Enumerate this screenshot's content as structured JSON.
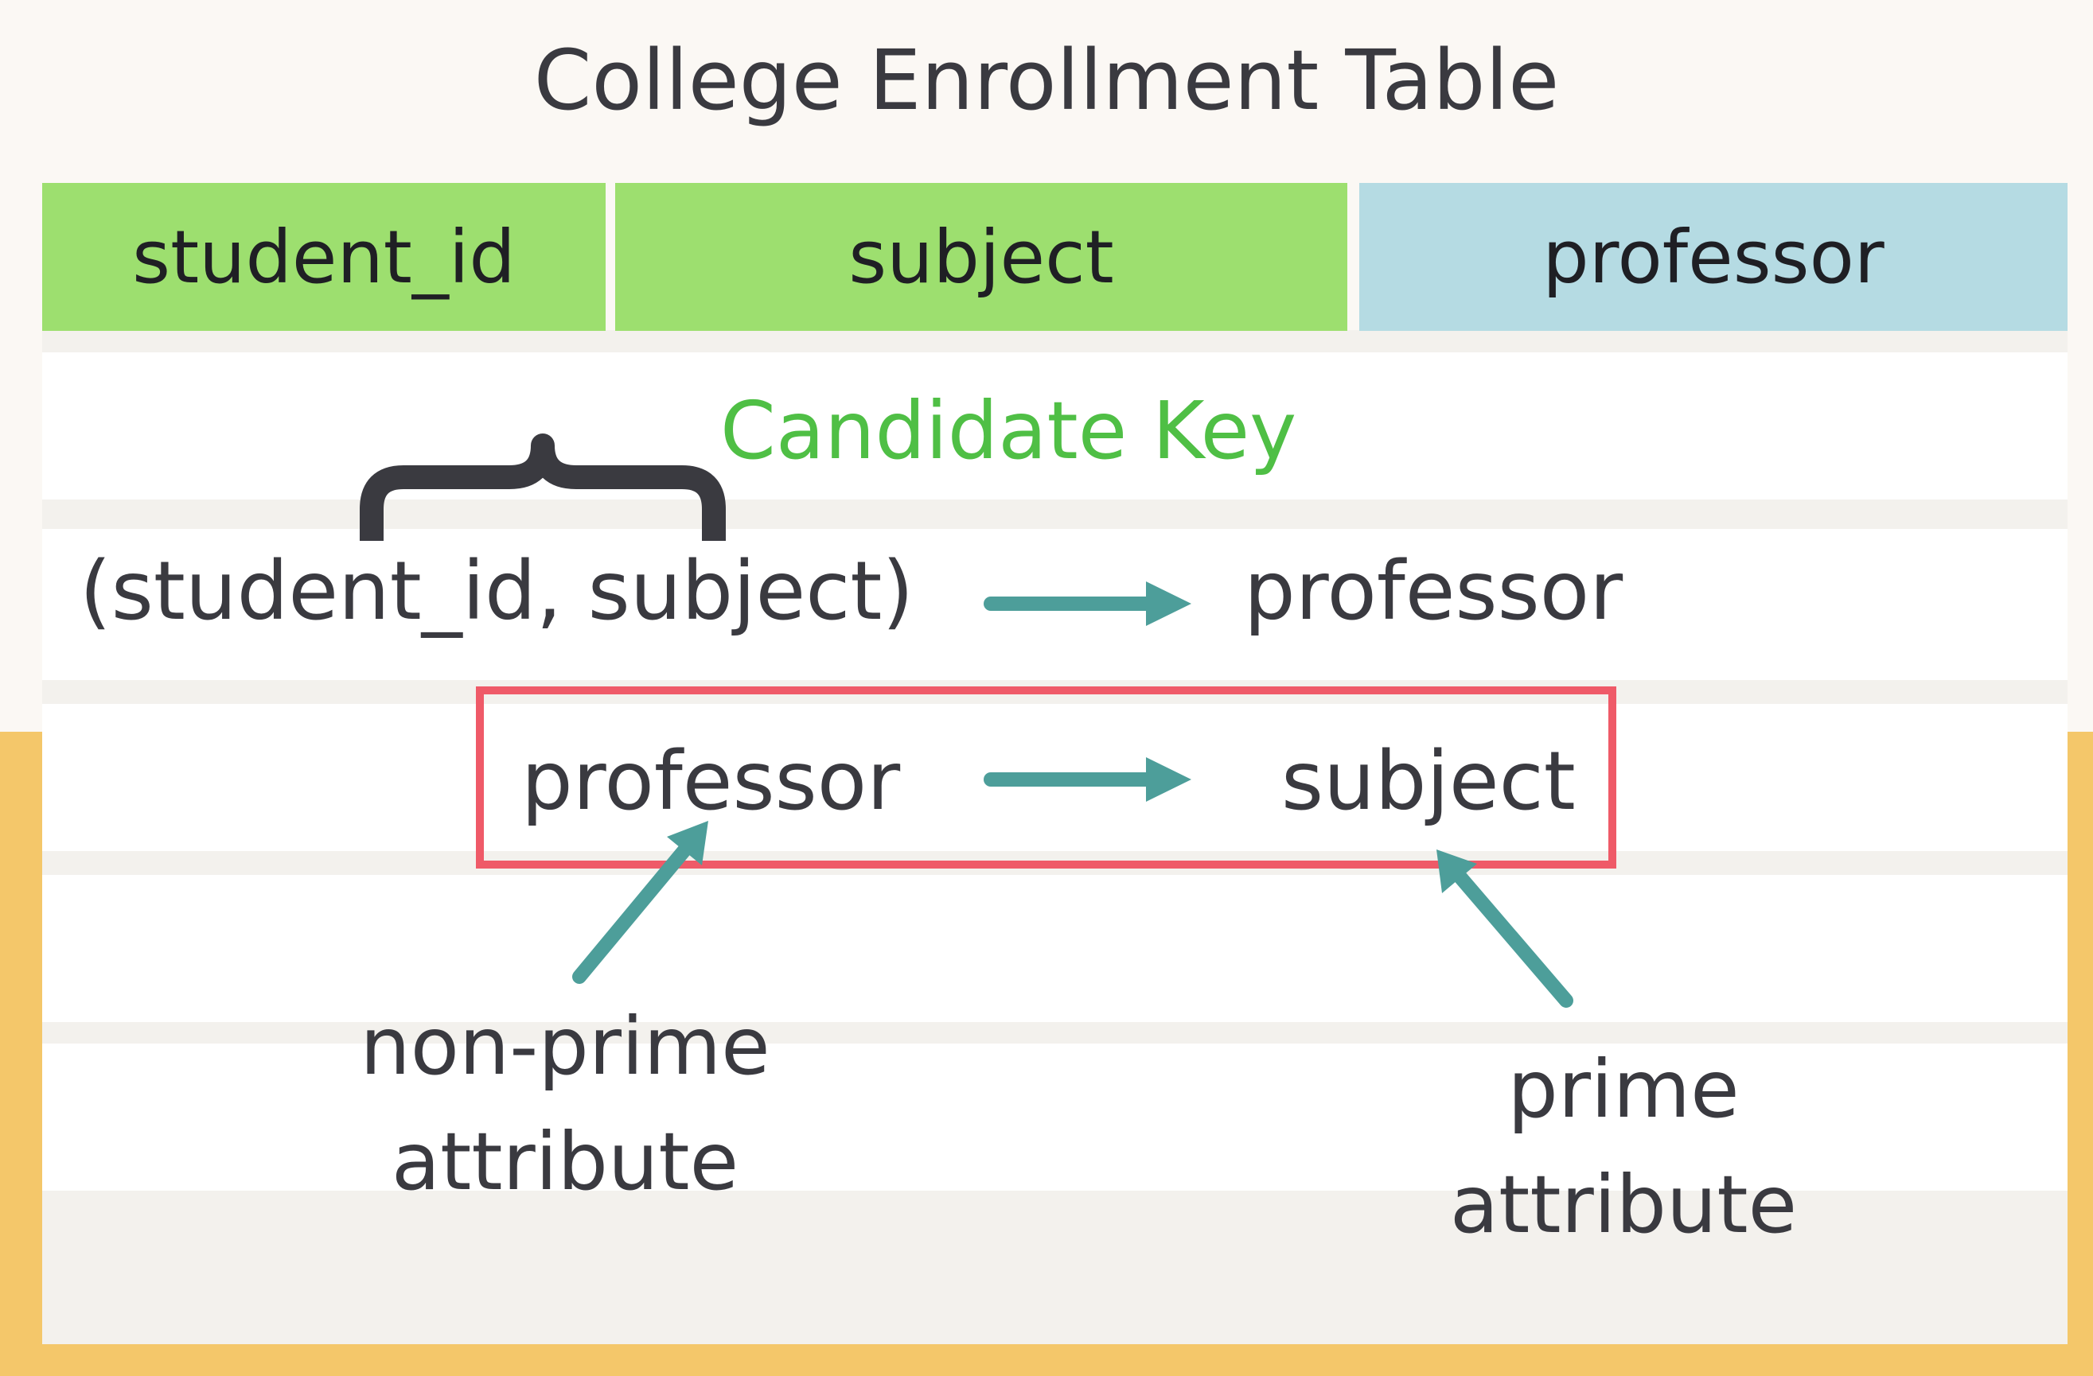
{
  "title": "College Enrollment Table",
  "table_headers": [
    "student_id",
    "subject",
    "professor"
  ],
  "candidate_key_label": "Candidate Key",
  "dependency_1": {
    "lhs": "(student_id, subject)",
    "rhs": "professor"
  },
  "dependency_2": {
    "lhs": "professor",
    "rhs": "subject"
  },
  "annotations": {
    "non_prime": [
      "non-prime",
      "attribute"
    ],
    "prime": [
      "prime",
      "attribute"
    ]
  },
  "colors": {
    "key_header": "#9ddf6f",
    "non_key_header": "#b5dbe3",
    "candidate_key_text": "#4fbf45",
    "arrow": "#4d9e9a",
    "highlight_box": "#ef5a68",
    "brace": "#3a3a40",
    "background_accent": "#f4c76a"
  }
}
